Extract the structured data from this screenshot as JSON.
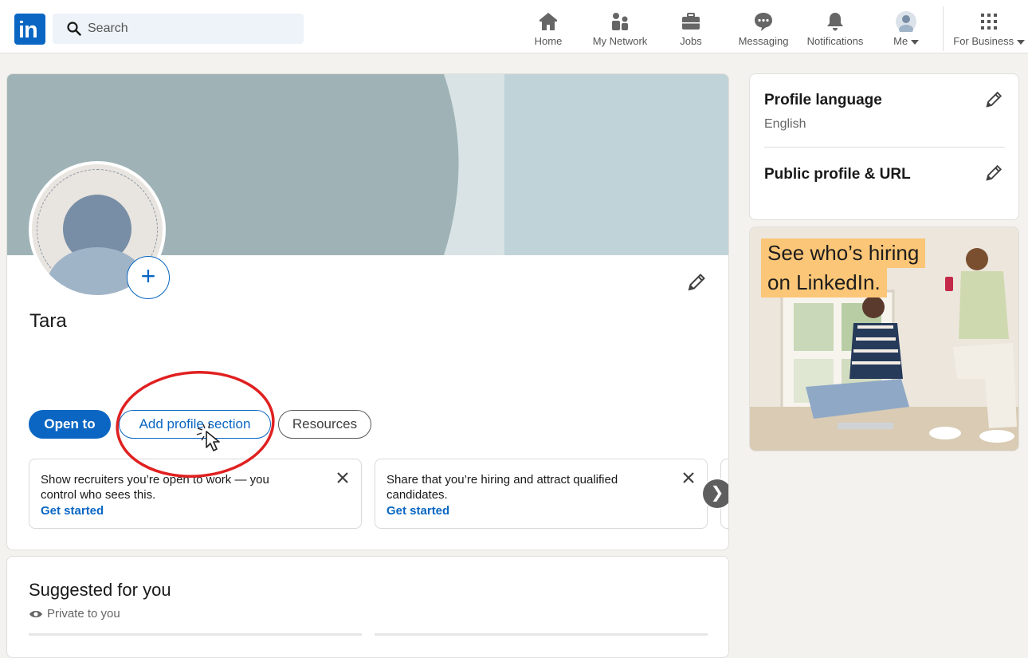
{
  "nav": {
    "logo_text": "in",
    "search_placeholder": "Search",
    "items": [
      {
        "label": "Home",
        "icon": "home-icon"
      },
      {
        "label": "My Network",
        "icon": "network-icon"
      },
      {
        "label": "Jobs",
        "icon": "briefcase-icon"
      },
      {
        "label": "Messaging",
        "icon": "messaging-icon"
      },
      {
        "label": "Notifications",
        "icon": "bell-icon"
      },
      {
        "label": "Me",
        "icon": "avatar-icon"
      },
      {
        "label": "For Business",
        "icon": "grid-icon"
      }
    ]
  },
  "profile": {
    "name": "Tara",
    "add_photo_symbol": "+",
    "buttons": {
      "open_to": "Open to",
      "add_section": "Add profile section",
      "resources": "Resources"
    },
    "recommendations": [
      {
        "bold": "Show recruiters you’re open to work",
        "rest": " — you control who sees this.",
        "cta": "Get started"
      },
      {
        "bold": "Share that you’re hiring",
        "rest": " and attract qualified candidates.",
        "cta": "Get started"
      }
    ],
    "next_symbol": "❯"
  },
  "suggested": {
    "title": "Suggested for you",
    "privacy": "Private to you"
  },
  "right_rail": {
    "language_title": "Profile language",
    "language_value": "English",
    "public_profile_title": "Public profile & URL"
  },
  "ad": {
    "line1": "See who’s hiring",
    "line2": "on LinkedIn."
  },
  "colors": {
    "brand_blue": "#0a66c2",
    "page_bg": "#f4f2ee",
    "highlight_red": "#e02020",
    "ad_yellow": "#fbc677"
  }
}
